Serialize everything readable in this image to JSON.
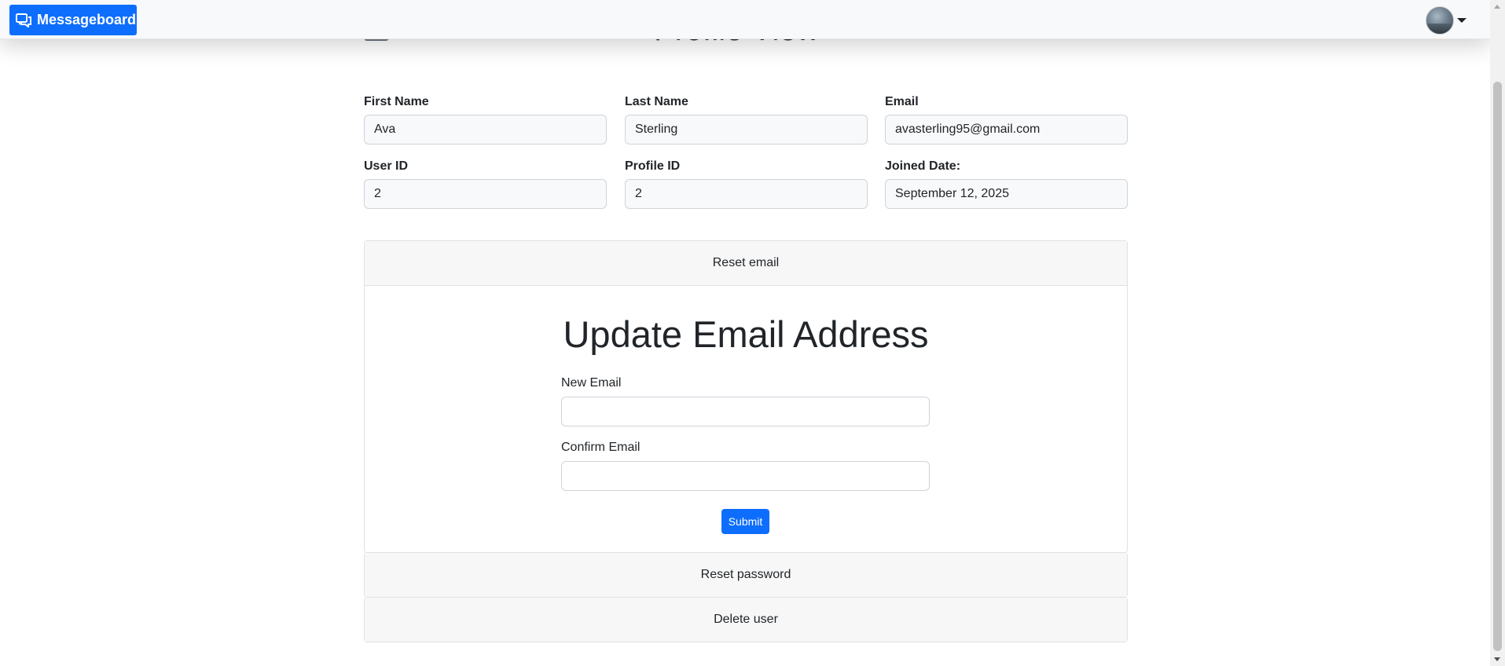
{
  "navbar": {
    "brand_label": "Messageboard",
    "brand_icon": "chat-bubbles-icon",
    "avatar_icon": "user-avatar",
    "caret_icon": "caret-down-icon"
  },
  "page": {
    "heading": "Profile View"
  },
  "profile": {
    "first_name_label": "First Name",
    "first_name_value": "Ava",
    "last_name_label": "Last Name",
    "last_name_value": "Sterling",
    "email_label": "Email",
    "email_value": "avasterling95@gmail.com",
    "user_id_label": "User ID",
    "user_id_value": "2",
    "profile_id_label": "Profile ID",
    "profile_id_value": "2",
    "joined_label": "Joined Date:",
    "joined_value": "September 12, 2025"
  },
  "accordion": {
    "reset_email_label": "Reset email",
    "reset_password_label": "Reset password",
    "delete_user_label": "Delete user"
  },
  "email_form": {
    "title": "Update Email Address",
    "new_email_label": "New Email",
    "new_email_value": "",
    "confirm_email_label": "Confirm Email",
    "confirm_email_value": "",
    "submit_label": "Submit"
  },
  "colors": {
    "primary": "#0d6efd",
    "navbar_bg": "#f8f9fa",
    "accordion_header_bg": "#f7f7f7"
  }
}
